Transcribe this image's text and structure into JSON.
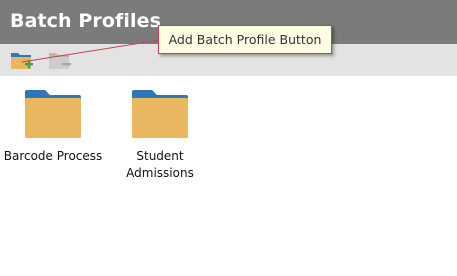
{
  "header": {
    "title": "Batch Profiles"
  },
  "toolbar": {
    "add_icon": "folder-add-icon",
    "remove_icon": "folder-remove-icon"
  },
  "tooltip": {
    "text": "Add Batch Profile Button"
  },
  "profiles": [
    {
      "label_line1": "Barcode Process",
      "label_line2": "",
      "icon": "folder-icon"
    },
    {
      "label_line1": "Student",
      "label_line2": "Admissions",
      "icon": "folder-icon"
    }
  ],
  "colors": {
    "titlebar": "#7b7b7b",
    "toolbar": "#e3e3e3",
    "folder_body": "#e8b75f",
    "folder_tab": "#2f77b8",
    "tooltip_bg": "#fefde3",
    "tooltip_border": "#c6444f",
    "add_plus": "#2eaa5c"
  }
}
